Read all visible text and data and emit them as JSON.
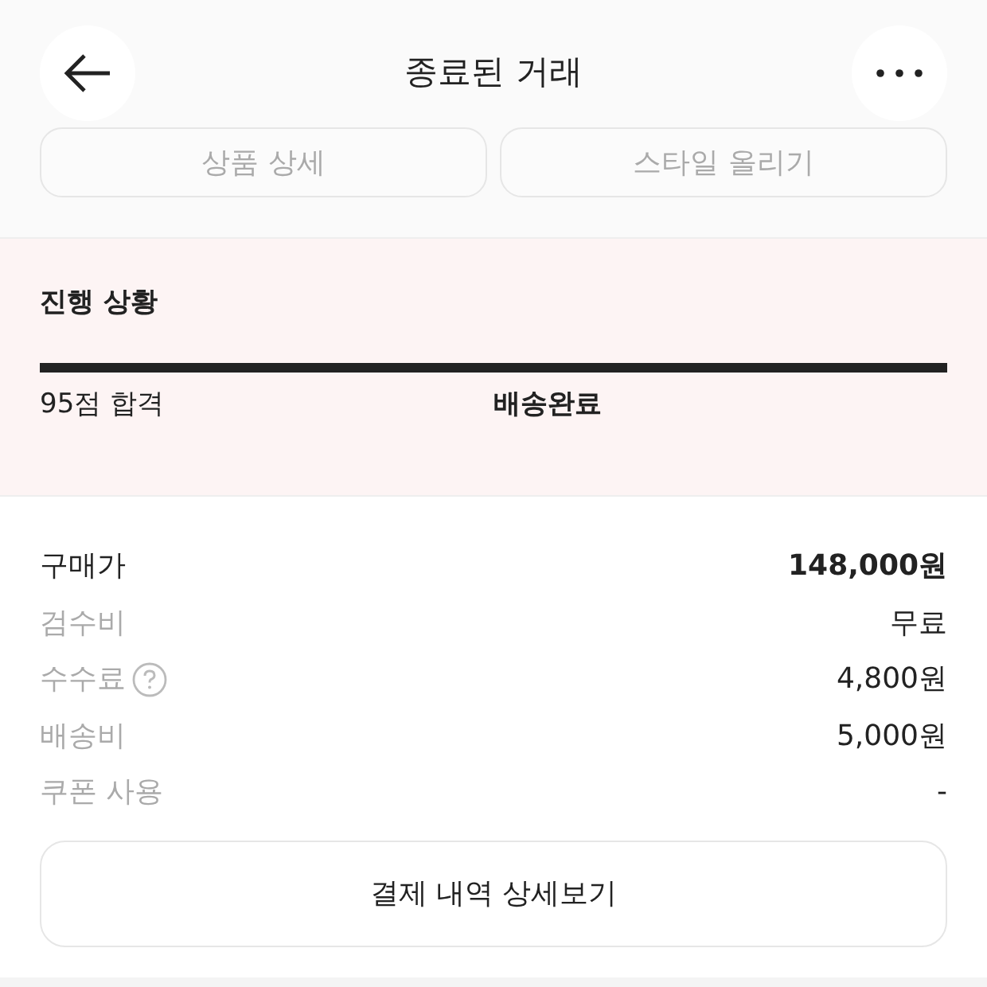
{
  "header": {
    "title": "종료된 거래"
  },
  "top_buttons": [
    {
      "label": "상품 상세",
      "disabled": true
    },
    {
      "label": "스타일 올리기",
      "disabled": true
    }
  ],
  "progress": {
    "title": "진행 상황",
    "level": 1,
    "steps": [
      {
        "label": "95점 합격",
        "selected": false
      },
      {
        "label": "배송완료",
        "selected": true
      }
    ]
  },
  "fees": [
    {
      "label": "구매가",
      "value": "148,000원",
      "emphasis": true,
      "help": false
    },
    {
      "label": "검수비",
      "value": "무료",
      "emphasis": false,
      "help": false
    },
    {
      "label": "수수료",
      "value": "4,800원",
      "emphasis": false,
      "help": true
    },
    {
      "label": "배송비",
      "value": "5,000원",
      "emphasis": false,
      "help": false
    },
    {
      "label": "쿠폰 사용",
      "value": "-",
      "emphasis": false,
      "help": false
    }
  ],
  "detail_button": "결제 내역 상세보기"
}
